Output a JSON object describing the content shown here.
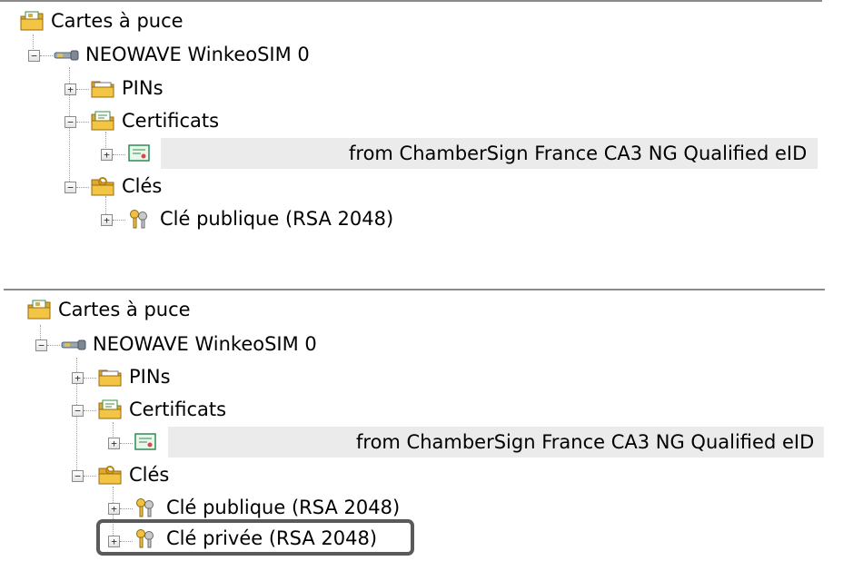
{
  "panels": [
    {
      "root": "Cartes à puce",
      "device": "NEOWAVE WinkeoSIM 0",
      "pins": "PINs",
      "certificats": "Certificats",
      "cert_item": "from ChamberSign France CA3 NG Qualified eID",
      "cles": "Clés",
      "public_key": "Clé publique (RSA 2048)"
    },
    {
      "root": "Cartes à puce",
      "device": "NEOWAVE WinkeoSIM 0",
      "pins": "PINs",
      "certificats": "Certificats",
      "cert_item": "from ChamberSign France CA3 NG Qualified eID",
      "cles": "Clés",
      "public_key": "Clé publique (RSA 2048)",
      "private_key": "Clé privée (RSA 2048)"
    }
  ],
  "expander_symbols": {
    "expanded": "−",
    "collapsed": "+"
  },
  "colors": {
    "highlight_border": "#5a5a5a",
    "row_selection": "#ebebeb",
    "folder": "#f3c545"
  }
}
